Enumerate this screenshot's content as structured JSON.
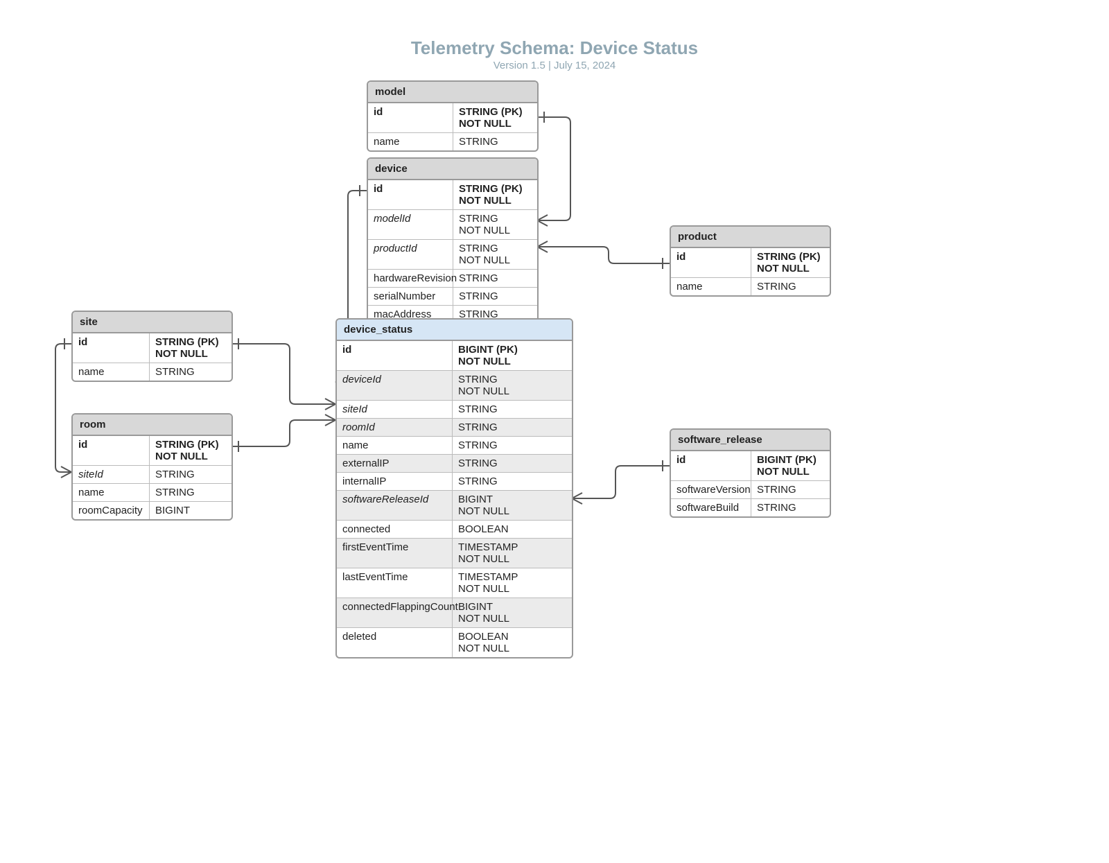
{
  "title": "Telemetry Schema: Device Status",
  "subtitle": "Version 1.5  |  July 15, 2024",
  "entities": {
    "model": {
      "name": "model",
      "rows": [
        {
          "name": "id",
          "type": "STRING (PK)\nNOT NULL",
          "pk": true
        },
        {
          "name": "name",
          "type": "STRING"
        }
      ]
    },
    "device": {
      "name": "device",
      "rows": [
        {
          "name": "id",
          "type": "STRING (PK)\nNOT NULL",
          "pk": true
        },
        {
          "name": "modelId",
          "type": "STRING\nNOT NULL",
          "fk": true
        },
        {
          "name": "productId",
          "type": "STRING\nNOT NULL",
          "fk": true
        },
        {
          "name": "hardwareRevision",
          "type": "STRING"
        },
        {
          "name": "serialNumber",
          "type": "STRING"
        },
        {
          "name": "macAddress",
          "type": "STRING"
        }
      ]
    },
    "device_status": {
      "name": "device_status",
      "rows": [
        {
          "name": "id",
          "type": "BIGINT (PK)\nNOT NULL",
          "pk": true
        },
        {
          "name": "deviceId",
          "type": "STRING\nNOT NULL",
          "fk": true,
          "shade": true
        },
        {
          "name": "siteId",
          "type": "STRING",
          "fk": true
        },
        {
          "name": "roomId",
          "type": "STRING",
          "fk": true,
          "shade": true
        },
        {
          "name": "name",
          "type": "STRING"
        },
        {
          "name": "externalIP",
          "type": "STRING",
          "shade": true
        },
        {
          "name": "internalIP",
          "type": "STRING"
        },
        {
          "name": "softwareReleaseId",
          "type": "BIGINT\nNOT NULL",
          "fk": true,
          "shade": true
        },
        {
          "name": "connected",
          "type": "BOOLEAN"
        },
        {
          "name": "firstEventTime",
          "type": "TIMESTAMP\nNOT NULL",
          "shade": true
        },
        {
          "name": "lastEventTime",
          "type": "TIMESTAMP\nNOT NULL"
        },
        {
          "name": "connectedFlappingCount",
          "type": "BIGINT\nNOT NULL",
          "shade": true
        },
        {
          "name": "deleted",
          "type": "BOOLEAN\nNOT NULL"
        }
      ]
    },
    "site": {
      "name": "site",
      "rows": [
        {
          "name": "id",
          "type": "STRING (PK)\nNOT NULL",
          "pk": true
        },
        {
          "name": "name",
          "type": "STRING"
        }
      ]
    },
    "room": {
      "name": "room",
      "rows": [
        {
          "name": "id",
          "type": "STRING (PK)\nNOT NULL",
          "pk": true
        },
        {
          "name": "siteId",
          "type": "STRING",
          "fk": true
        },
        {
          "name": "name",
          "type": "STRING"
        },
        {
          "name": "roomCapacity",
          "type": "BIGINT"
        }
      ]
    },
    "product": {
      "name": "product",
      "rows": [
        {
          "name": "id",
          "type": "STRING (PK)\nNOT NULL",
          "pk": true
        },
        {
          "name": "name",
          "type": "STRING"
        }
      ]
    },
    "software_release": {
      "name": "software_release",
      "rows": [
        {
          "name": "id",
          "type": "BIGINT (PK)\nNOT NULL",
          "pk": true
        },
        {
          "name": "softwareVersion",
          "type": "STRING"
        },
        {
          "name": "softwareBuild",
          "type": "STRING"
        }
      ]
    }
  }
}
